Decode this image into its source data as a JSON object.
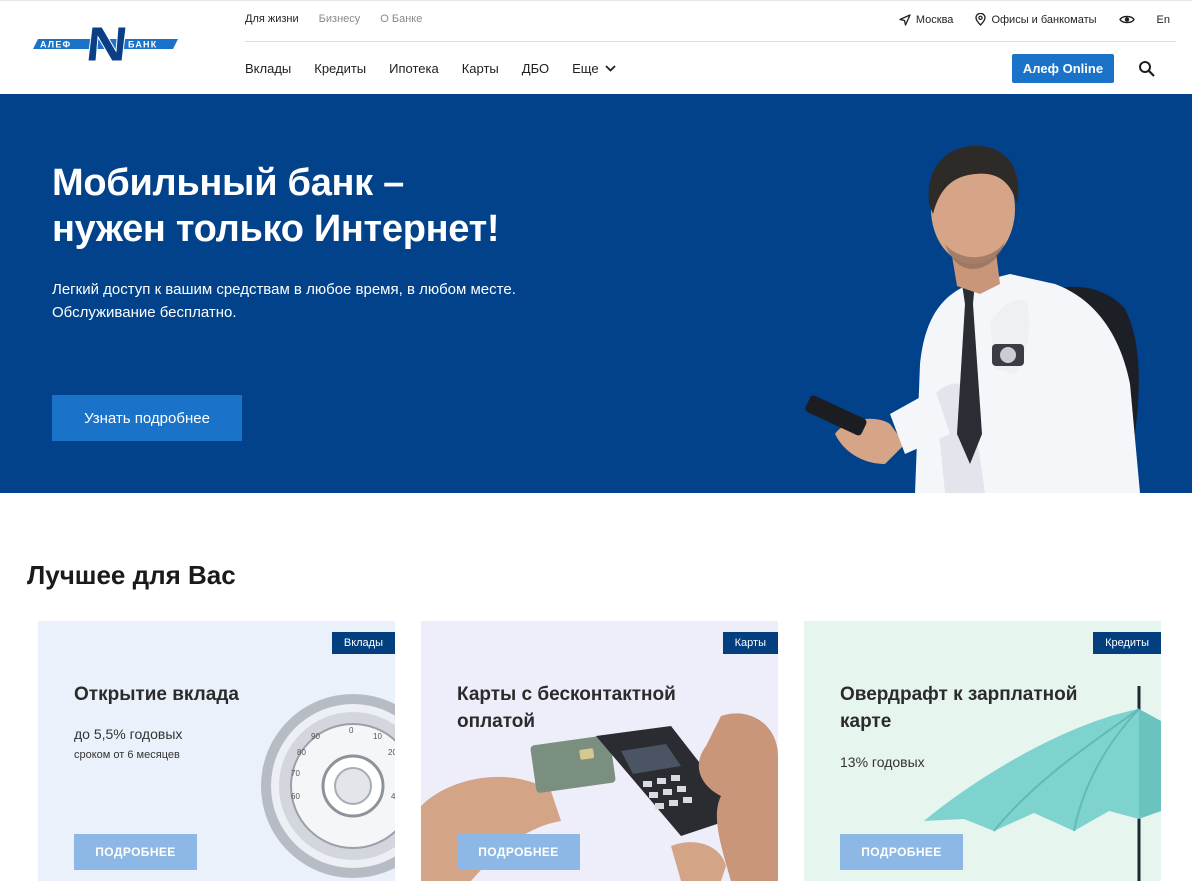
{
  "brand": {
    "logo_text": "АЛЕФБАНК",
    "color": "#1a73c9",
    "dark": "#02428a"
  },
  "topnav": {
    "items": [
      "Для жизни",
      "Бизнесу",
      "О Банке"
    ],
    "active": "Для жизни"
  },
  "utility": {
    "city": "Москва",
    "offices": "Офисы и банкоматы",
    "lang": "En",
    "accessibility_icon": "eye-icon"
  },
  "mainnav": {
    "items": [
      "Вклады",
      "Кредиты",
      "Ипотека",
      "Карты",
      "ДБО"
    ],
    "more": "Еще"
  },
  "header": {
    "online_button": "Алеф Online",
    "search_icon": "search-icon"
  },
  "hero": {
    "title_line1": "Мобильный банк –",
    "title_line2": "нужен только Интернет!",
    "subtitle_line1": "Легкий доступ к вашим средствам в любое время, в любом месте.",
    "subtitle_line2": "Обслуживание бесплатно.",
    "button": "Узнать подробнее"
  },
  "best": {
    "title": "Лучшее для Вас",
    "cards": [
      {
        "badge": "Вклады",
        "title": "Открытие вклада",
        "line1": "до 5,5% годовых",
        "line2": "сроком от 6 месяцев",
        "button": "ПОДРОБНЕЕ",
        "art": "safe-dial-icon"
      },
      {
        "badge": "Карты",
        "title": "Карты с бесконтактной оплатой",
        "line1": "",
        "line2": "",
        "button": "ПОДРОБНЕЕ",
        "art": "payment-terminal-icon"
      },
      {
        "badge": "Кредиты",
        "title": "Овердрафт к зарплатной карте",
        "line1": "13% годовых",
        "line2": "",
        "button": "ПОДРОБНЕЕ",
        "art": "umbrella-icon"
      }
    ]
  }
}
